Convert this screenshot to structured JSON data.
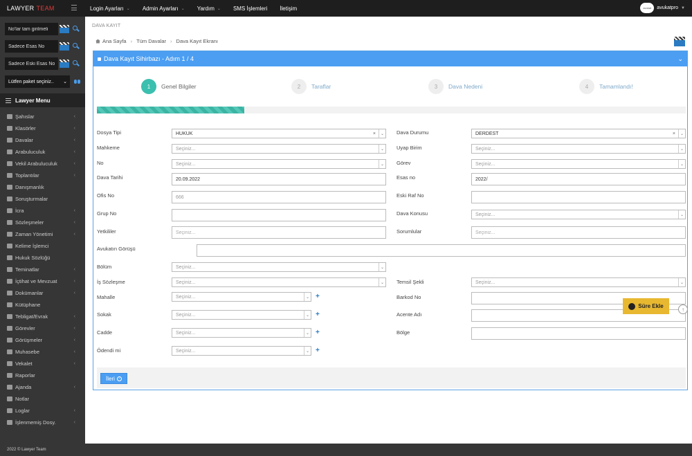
{
  "brand": {
    "name": "LAWYER",
    "accent": "TEAM"
  },
  "topnav": [
    {
      "label": "Login Ayarları",
      "has_caret": true
    },
    {
      "label": "Admin Ayarları",
      "has_caret": true
    },
    {
      "label": "Yardım",
      "has_caret": true
    },
    {
      "label": "SMS İşlemleri",
      "has_caret": false
    },
    {
      "label": "İletişim",
      "has_caret": false
    }
  ],
  "user": {
    "avatar_text": "avukat",
    "name": "avukatpro"
  },
  "sidebar": {
    "search1_placeholder": "No'lar tam girilmeli",
    "search2_placeholder": "Sadece Esas No",
    "search3_placeholder": "Sadece Eski Esas No",
    "package_select": "Lütfen paket seçiniz..",
    "menu_title": "Lawyer Menu",
    "items": [
      {
        "label": "Şahıslar",
        "chev": true
      },
      {
        "label": "Klasörler",
        "chev": true
      },
      {
        "label": "Davalar",
        "chev": true
      },
      {
        "label": "Arabuluculuk",
        "chev": true
      },
      {
        "label": "Vekil Arabuluculuk",
        "chev": true
      },
      {
        "label": "Toplantılar",
        "chev": true
      },
      {
        "label": "Danışmanlık",
        "chev": false
      },
      {
        "label": "Soruşturmalar",
        "chev": false
      },
      {
        "label": "İcra",
        "chev": true
      },
      {
        "label": "Sözleşmeler",
        "chev": true
      },
      {
        "label": "Zaman Yönetimi",
        "chev": true
      },
      {
        "label": "Kelime İşlemci",
        "chev": false
      },
      {
        "label": "Hukuk Sözlüğü",
        "chev": false
      },
      {
        "label": "Teminatlar",
        "chev": true
      },
      {
        "label": "İçtihat ve Mevzuat",
        "chev": true
      },
      {
        "label": "Dokümanlar",
        "chev": true
      },
      {
        "label": "Kütüphane",
        "chev": false
      },
      {
        "label": "Tebligat/Evrak",
        "chev": true
      },
      {
        "label": "Görevler",
        "chev": true
      },
      {
        "label": "Görüşmeler",
        "chev": true
      },
      {
        "label": "Muhasebe",
        "chev": true
      },
      {
        "label": "Vekalet",
        "chev": true
      },
      {
        "label": "Raporlar",
        "chev": false
      },
      {
        "label": "Ajanda",
        "chev": true
      },
      {
        "label": "Notlar",
        "chev": false
      },
      {
        "label": "Loglar",
        "chev": true
      },
      {
        "label": "İşlenmemiş Dosy.",
        "chev": true
      }
    ]
  },
  "copyright": "2022 © Lawyer Team",
  "page": {
    "title": "DAVA KAYIT",
    "breadcrumb": [
      "Ana Sayfa",
      "Tüm Davalar",
      "Dava Kayıt Ekranı"
    ]
  },
  "wizard": {
    "title": "Dava Kayıt Sihirbazı - Adım 1 / 4",
    "steps": [
      {
        "num": "1",
        "label": "Genel Bilgiler",
        "active": true
      },
      {
        "num": "2",
        "label": "Taraflar",
        "active": false
      },
      {
        "num": "3",
        "label": "Dava Nedeni",
        "active": false
      },
      {
        "num": "4",
        "label": "Tamamlandı!",
        "active": false
      }
    ],
    "progress": 0.25,
    "next_label": "İleri",
    "sure_label": "Süre Ekle"
  },
  "form": {
    "placeholder": "Seçiniz...",
    "dosya_tipi": {
      "label": "Dosya Tipi",
      "value": "HUKUK"
    },
    "dava_durumu": {
      "label": "Dava Durumu",
      "value": "DERDEST"
    },
    "mahkeme": {
      "label": "Mahkeme"
    },
    "uyap_birim": {
      "label": "Uyap Birim"
    },
    "no": {
      "label": "No"
    },
    "gorev": {
      "label": "Görev"
    },
    "dava_tarihi": {
      "label": "Dava Tarihi",
      "value": "20.09.2022"
    },
    "esas_no": {
      "label": "Esas no",
      "value": "2022/"
    },
    "ofis_no": {
      "label": "Ofis No",
      "value": "666"
    },
    "eski_raf_no": {
      "label": "Eski Raf No"
    },
    "grup_no": {
      "label": "Grup No"
    },
    "dava_konusu": {
      "label": "Dava Konusu"
    },
    "yetkililer": {
      "label": "Yetkililer",
      "placeholder": "Seçiniz..."
    },
    "sorumlular": {
      "label": "Sorumlular",
      "placeholder": "Seçiniz..."
    },
    "avukat_gorusu": {
      "label": "Avukatın Görüşü"
    },
    "bolum": {
      "label": "Bölüm"
    },
    "is_sozlesme": {
      "label": "İş Sözleşme"
    },
    "temsil_sekli": {
      "label": "Temsil Şekli"
    },
    "mahalle": {
      "label": "Mahalle"
    },
    "barkod_no": {
      "label": "Barkod No"
    },
    "sokak": {
      "label": "Sokak"
    },
    "acente_adi": {
      "label": "Acente Adı"
    },
    "cadde": {
      "label": "Cadde"
    },
    "bolge": {
      "label": "Bölge"
    },
    "odendi_mi": {
      "label": "Ödendi mi"
    }
  }
}
